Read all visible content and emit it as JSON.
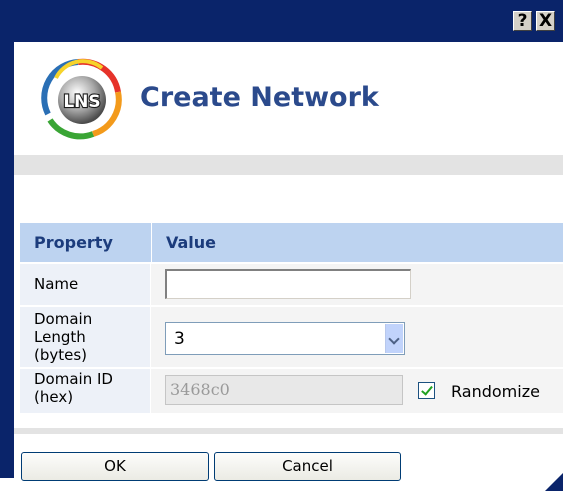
{
  "window": {
    "help_glyph": "?",
    "close_glyph": "X",
    "frame_color": "#0a246a"
  },
  "header": {
    "logo_text": "LNS",
    "title": "Create Network",
    "title_color": "#2b4a8c"
  },
  "table": {
    "columns": [
      "Property",
      "Value"
    ],
    "rows": {
      "name": {
        "label": "Name",
        "value": ""
      },
      "domain_length": {
        "label_lines": [
          "Domain",
          "Length",
          "(bytes)"
        ],
        "value": "3"
      },
      "domain_id": {
        "label_lines": [
          "Domain ID",
          "(hex)"
        ],
        "value": "3468c0",
        "disabled": true
      }
    },
    "randomize": {
      "label": "Randomize",
      "checked": true
    }
  },
  "buttons": {
    "ok": "OK",
    "cancel": "Cancel"
  },
  "icons": [
    "help-icon",
    "close-icon",
    "lns-logo",
    "dropdown-arrow-icon",
    "checkmark-icon"
  ]
}
